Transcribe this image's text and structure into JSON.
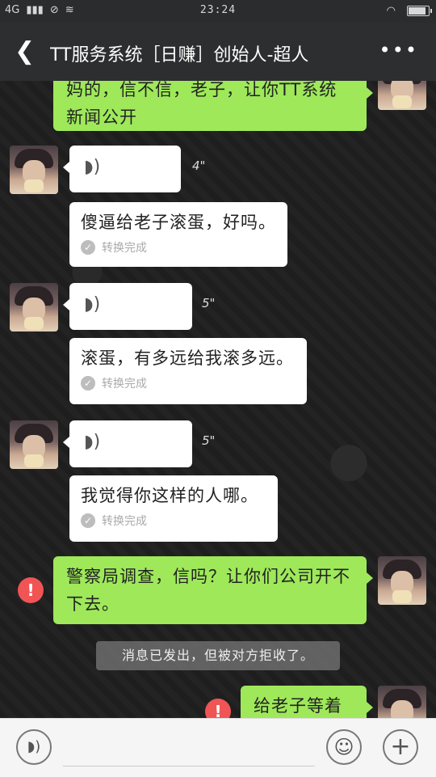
{
  "status": {
    "network": "4G",
    "time": "23:24"
  },
  "header": {
    "title": "TT服务系统［日赚］创始人-超人",
    "back_icon": "back-chevron-icon",
    "more_icon": "more-dots-icon"
  },
  "messages": [
    {
      "type": "text",
      "side": "right",
      "text": "妈的，信不信，老子，让你TT系统新闻公开"
    },
    {
      "type": "voice",
      "side": "left",
      "duration": "4\""
    },
    {
      "type": "transcript",
      "side": "left",
      "text": "傻逼给老子滚蛋，好吗。",
      "status": "转换完成"
    },
    {
      "type": "voice",
      "side": "left",
      "duration": "5\""
    },
    {
      "type": "transcript",
      "side": "left",
      "text": "滚蛋，有多远给我滚多远。",
      "status": "转换完成"
    },
    {
      "type": "voice",
      "side": "left",
      "duration": "5\""
    },
    {
      "type": "transcript",
      "side": "left",
      "text": "我觉得你这样的人哪。",
      "status": "转换完成"
    },
    {
      "type": "text",
      "side": "right",
      "error": true,
      "text": "警察局调查，信吗？让你们公司开不下去。"
    },
    {
      "type": "system",
      "text": "消息已发出，但被对方拒收了。"
    },
    {
      "type": "text",
      "side": "right",
      "error": true,
      "text": "给老子等着"
    }
  ],
  "inputbar": {
    "voice_icon": "voice-input-icon",
    "emoji_icon": "emoji-icon",
    "plus_icon": "plus-icon"
  },
  "colors": {
    "green_bubble": "#9ee85a",
    "error_red": "#f05454",
    "titlebar": "#2d2e30"
  }
}
